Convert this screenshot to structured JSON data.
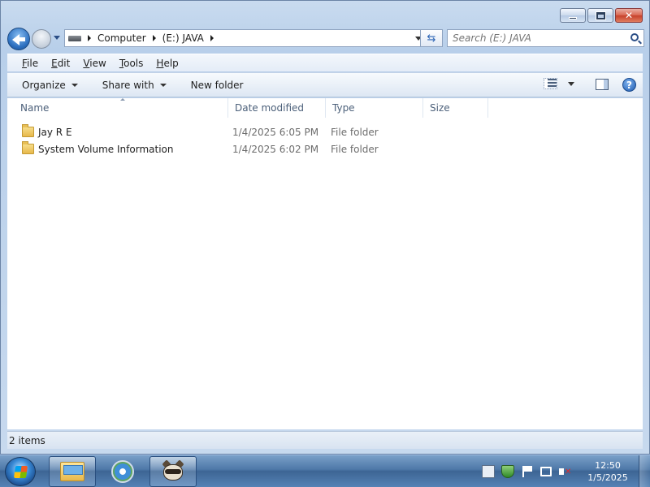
{
  "address": {
    "crumbs": [
      "Computer",
      "(E:) JAVA"
    ]
  },
  "search": {
    "placeholder": "Search (E:) JAVA"
  },
  "menu": {
    "items": [
      {
        "label": "File",
        "accel": "F",
        "rest": "ile"
      },
      {
        "label": "Edit",
        "accel": "E",
        "rest": "dit"
      },
      {
        "label": "View",
        "accel": "V",
        "rest": "iew"
      },
      {
        "label": "Tools",
        "accel": "T",
        "rest": "ools"
      },
      {
        "label": "Help",
        "accel": "H",
        "rest": "elp"
      }
    ]
  },
  "toolbar": {
    "organize": "Organize",
    "share_with": "Share with",
    "new_folder": "New folder",
    "help_glyph": "?"
  },
  "columns": {
    "name": "Name",
    "date_modified": "Date modified",
    "type": "Type",
    "size": "Size"
  },
  "files": [
    {
      "name": "Jay R E",
      "date_modified": "1/4/2025 6:05 PM",
      "type": "File folder",
      "size": ""
    },
    {
      "name": "System Volume Information",
      "date_modified": "1/4/2025 6:02 PM",
      "type": "File folder",
      "size": ""
    }
  ],
  "status": {
    "item_count": "2 items"
  },
  "taskbar": {
    "clock_time": "12:50",
    "clock_date": "1/5/2025"
  },
  "colors": {
    "window_frame": "#b8cfea",
    "taskbar": "#4d77a7",
    "close_button": "#c6412b"
  }
}
